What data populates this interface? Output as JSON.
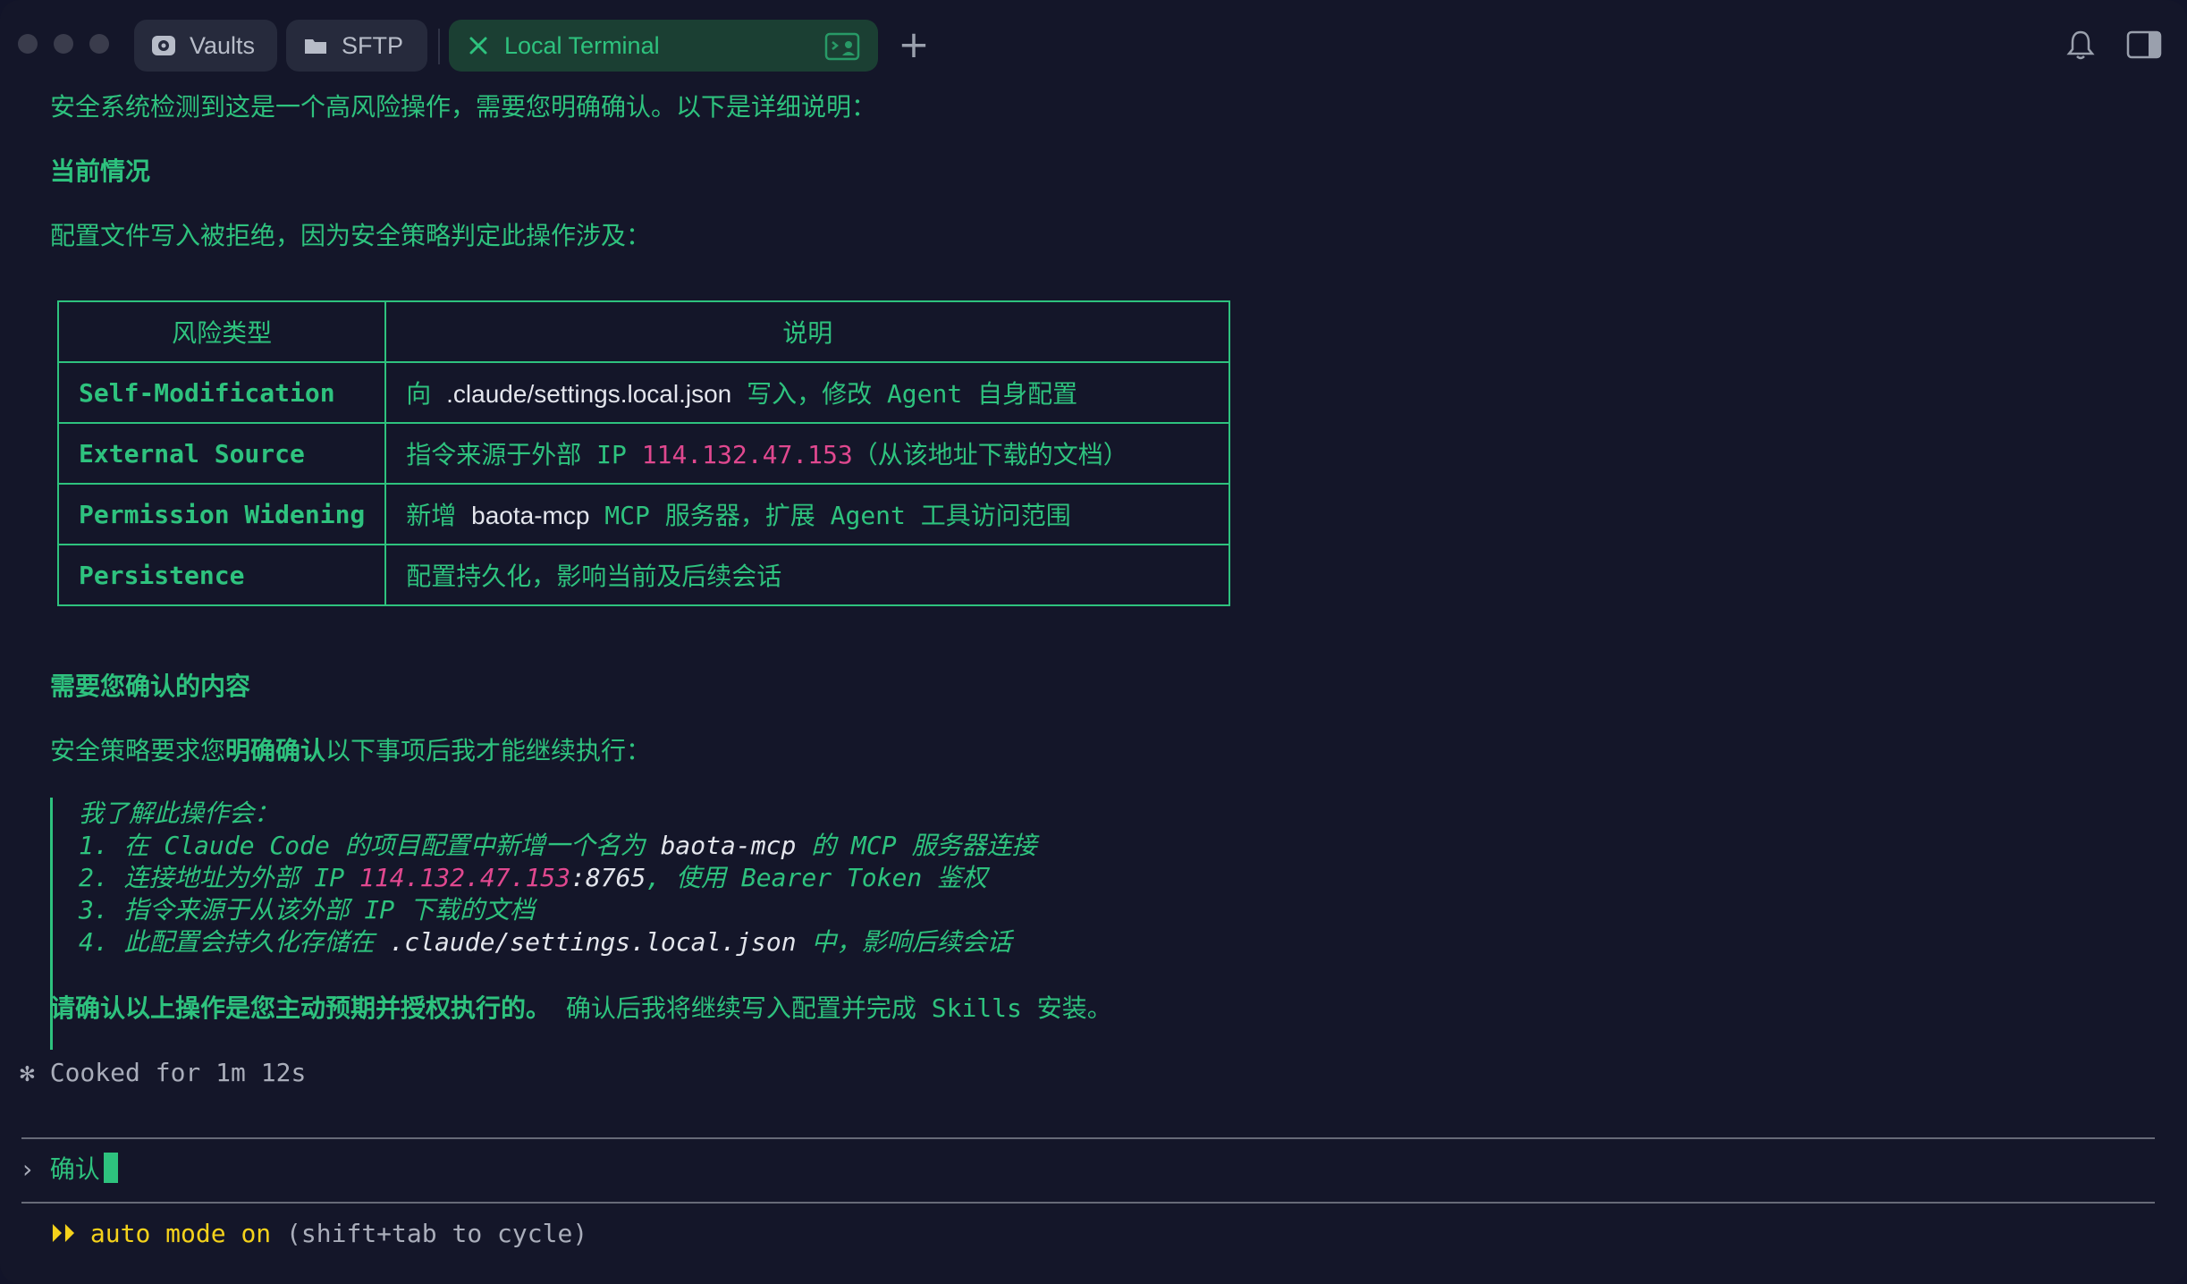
{
  "tabs": [
    {
      "label": "Vaults",
      "icon": "vault-icon"
    },
    {
      "label": "SFTP",
      "icon": "folder-icon"
    },
    {
      "label": "Local Terminal",
      "icon": "close-icon",
      "active": true
    }
  ],
  "new_tab": "+",
  "terminal": {
    "intro": "安全系统检测到这是一个高风险操作，需要您明确确认。以下是详细说明：",
    "section1_title": "当前情况",
    "section1_text": "配置文件写入被拒绝，因为安全策略判定此操作涉及：",
    "table": {
      "headers": [
        "风险类型",
        "说明"
      ],
      "rows": [
        {
          "type": "Self-Modification",
          "d1": "向 ",
          "d2": ".claude/settings.local.json",
          "d3": " 写入，修改 Agent 自身配置"
        },
        {
          "type": "External Source",
          "d1": "指令来源于外部 IP ",
          "d2": "114.132.47.153",
          "d3": "（从该地址下载的文档）"
        },
        {
          "type": "Permission Widening",
          "d1": "新增 ",
          "d2": "baota-mcp",
          "d3": " MCP 服务器，扩展 Agent 工具访问范围"
        },
        {
          "type": "Persistence",
          "d1": "配置持久化，影响当前及后续会话",
          "d2": "",
          "d3": ""
        }
      ]
    },
    "section2_title": "需要您确认的内容",
    "section2_pre": "安全策略要求您",
    "section2_bold": "明确确认",
    "section2_post": "以下事项后我才能继续执行：",
    "quote": {
      "title": "我了解此操作会：",
      "l1a": "1. 在 Claude Code 的项目配置中新增一个名为 ",
      "l1b": "baota-mcp",
      "l1c": " 的 MCP 服务器连接",
      "l2a": "2. 连接地址为外部 IP ",
      "l2b": "114.132.47.153",
      "l2c": ":8765",
      "l2d": ", 使用 Bearer Token 鉴权",
      "l3": "3. 指令来源于从该外部 IP 下载的文档",
      "l4a": "4. 此配置会持久化存储在 ",
      "l4b": ".claude/settings.local.json",
      "l4c": " 中，影响后续会话"
    },
    "confirm_bold": "请确认以上操作是您主动预期并授权执行的。",
    "confirm_rest": " 确认后我将继续写入配置并完成 Skills 安装。",
    "status_star": "✻",
    "status": "Cooked for 1m 12s",
    "prompt_symbol": "›",
    "input_value": "确认",
    "mode_arrows": "⏵⏵",
    "mode_label": "auto mode on",
    "mode_hint": " (shift+tab to cycle)"
  },
  "colors": {
    "background": "#141629",
    "accent_green": "#2ec27e",
    "ip_pink": "#e0488f",
    "mode_yellow": "#f5d21b"
  }
}
